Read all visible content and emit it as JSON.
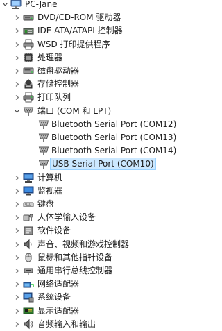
{
  "root": {
    "label": "PC-Jane",
    "icon": "computer-icon",
    "expanded": true
  },
  "nodes": [
    {
      "label": "DVD/CD-ROM 驱动器",
      "icon": "dvd-drive-icon",
      "expanded": false
    },
    {
      "label": "IDE ATA/ATAPI 控制器",
      "icon": "ide-controller-icon",
      "expanded": false
    },
    {
      "label": "WSD 打印提供程序",
      "icon": "wsd-printer-icon",
      "expanded": false
    },
    {
      "label": "处理器",
      "icon": "processor-icon",
      "expanded": false
    },
    {
      "label": "磁盘驱动器",
      "icon": "disk-drive-icon",
      "expanded": false
    },
    {
      "label": "存储控制器",
      "icon": "storage-controller-icon",
      "expanded": false
    },
    {
      "label": "打印队列",
      "icon": "print-queue-icon",
      "expanded": false
    },
    {
      "label": "端口 (COM 和 LPT)",
      "icon": "port-icon",
      "expanded": true,
      "children": [
        {
          "label": "Bluetooth Serial Port (COM12)",
          "icon": "port-icon"
        },
        {
          "label": "Bluetooth Serial Port (COM13)",
          "icon": "port-icon"
        },
        {
          "label": "Bluetooth Serial Port (COM14)",
          "icon": "port-icon"
        },
        {
          "label": "USB Serial Port (COM10)",
          "icon": "port-icon",
          "selected": true
        }
      ]
    },
    {
      "label": "计算机",
      "icon": "computer-monitor-icon",
      "expanded": false
    },
    {
      "label": "监视器",
      "icon": "monitor-icon",
      "expanded": false
    },
    {
      "label": "键盘",
      "icon": "keyboard-icon",
      "expanded": false
    },
    {
      "label": "人体学输入设备",
      "icon": "hid-icon",
      "expanded": false
    },
    {
      "label": "软件设备",
      "icon": "software-device-icon",
      "expanded": false
    },
    {
      "label": "声音、视频和游戏控制器",
      "icon": "speaker-icon",
      "expanded": false
    },
    {
      "label": "鼠标和其他指针设备",
      "icon": "mouse-icon",
      "expanded": false
    },
    {
      "label": "通用串行总线控制器",
      "icon": "usb-controller-icon",
      "expanded": false
    },
    {
      "label": "网络适配器",
      "icon": "network-adapter-icon",
      "expanded": false
    },
    {
      "label": "系统设备",
      "icon": "system-device-icon",
      "expanded": false
    },
    {
      "label": "显示适配器",
      "icon": "display-adapter-icon",
      "expanded": false
    },
    {
      "label": "音频输入和输出",
      "icon": "audio-io-icon",
      "expanded": false
    }
  ],
  "colors": {
    "selection_bg": "#cce8ff",
    "selection_border": "#99d1ff",
    "text": "#1e1e1e",
    "expander": "#7a7a7a"
  }
}
